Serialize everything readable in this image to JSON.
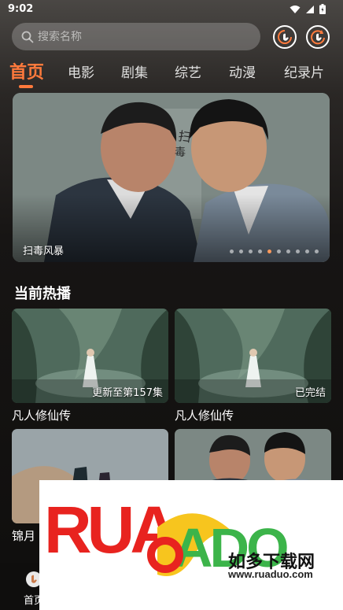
{
  "status_bar": {
    "time": "9:02"
  },
  "search": {
    "placeholder": "搜索名称"
  },
  "header_buttons": [
    "history-icon",
    "refresh-icon"
  ],
  "tabs": [
    {
      "label": "首页",
      "active": true
    },
    {
      "label": "电影"
    },
    {
      "label": "剧集"
    },
    {
      "label": "综艺"
    },
    {
      "label": "动漫"
    },
    {
      "label": "纪录片"
    }
  ],
  "banner": {
    "title": "扫毒风暴",
    "dots_count": 10,
    "active_dot": 4
  },
  "section": {
    "title": "当前热播"
  },
  "cards": [
    {
      "title": "凡人修仙传",
      "badge": "更新至第157集"
    },
    {
      "title": "凡人修仙传",
      "badge": "已完结"
    },
    {
      "title": "锦月"
    },
    {
      "title": ""
    }
  ],
  "bottom_nav": {
    "home_label": "首页"
  },
  "watermark": {
    "logo_text": "RUADADO",
    "cn_text": "如多下载网",
    "url": "www.ruaduo.com"
  },
  "colors": {
    "accent": "#ff7a3c",
    "background": "#171514",
    "watermark_red": "#e8231f",
    "watermark_green": "#3cb44a",
    "watermark_yellow": "#f7c51e"
  }
}
